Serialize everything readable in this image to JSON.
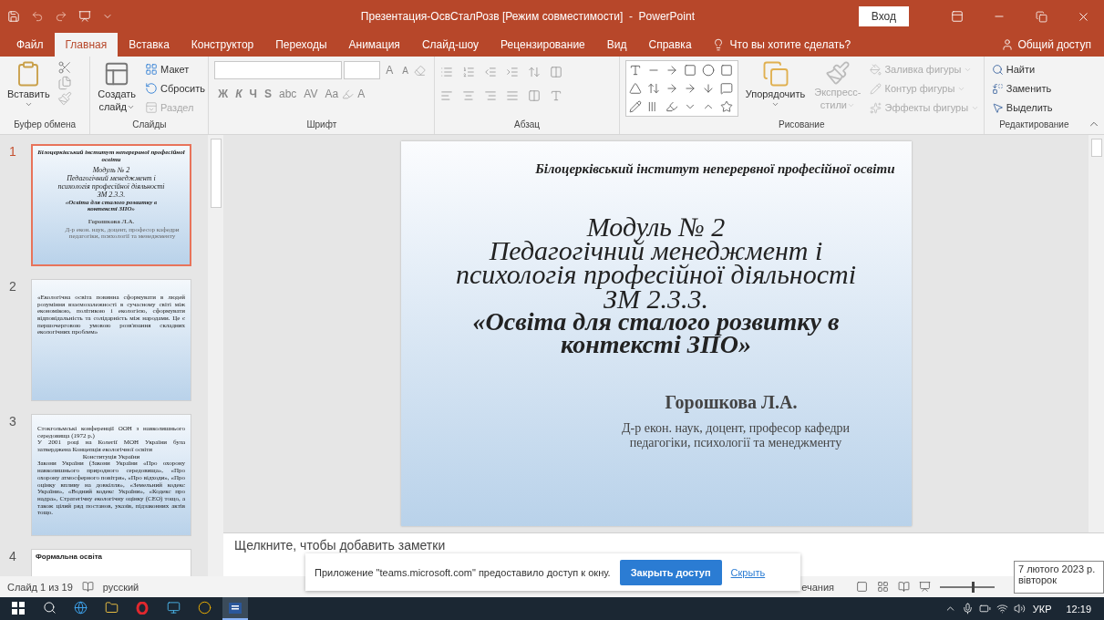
{
  "window": {
    "title": "Презентация-ОсвСталРозв [Режим совместимости]  -  PowerPoint",
    "signin": "Вход"
  },
  "menu_tabs": [
    {
      "label": "Файл",
      "selected": false
    },
    {
      "label": "Главная",
      "selected": true
    },
    {
      "label": "Вставка",
      "selected": false
    },
    {
      "label": "Конструктор",
      "selected": false
    },
    {
      "label": "Переходы",
      "selected": false
    },
    {
      "label": "Анимация",
      "selected": false
    },
    {
      "label": "Слайд-шоу",
      "selected": false
    },
    {
      "label": "Рецензирование",
      "selected": false
    },
    {
      "label": "Вид",
      "selected": false
    },
    {
      "label": "Справка",
      "selected": false
    }
  ],
  "tell_me": "Что вы хотите сделать?",
  "share": "Общий доступ",
  "ribbon": {
    "clipboard": {
      "label": "Буфер обмена",
      "paste": "Вставить"
    },
    "slides": {
      "label": "Слайды",
      "new_slide": [
        "Создать",
        "слайд"
      ],
      "items": [
        {
          "label": "Макет",
          "disabled": false
        },
        {
          "label": "Сбросить",
          "disabled": false
        },
        {
          "label": "Раздел",
          "disabled": true
        }
      ]
    },
    "font": {
      "label": "Шрифт",
      "grow": "A",
      "shrink": "A",
      "styles": [
        "Ж",
        "К",
        "Ч",
        "S",
        "abc",
        "AV",
        "Aa"
      ],
      "text_color_letter": "A"
    },
    "paragraph": {
      "label": "Абзац"
    },
    "drawing": {
      "label": "Рисование",
      "arrange": "Упорядочить",
      "quick_styles": [
        "Экспресс-",
        "стили"
      ],
      "items": [
        {
          "label": "Заливка фигуры",
          "disabled": true
        },
        {
          "label": "Контур фигуры",
          "disabled": true
        },
        {
          "label": "Эффекты фигуры",
          "disabled": true
        }
      ]
    },
    "editing": {
      "label": "Редактирование",
      "items": [
        {
          "label": "Найти"
        },
        {
          "label": "Заменить"
        },
        {
          "label": "Выделить"
        }
      ]
    }
  },
  "thumbnails": [
    {
      "number": "1",
      "selected": true,
      "kind": "title",
      "header": "Білоцерківський інститут неперервної професійної освіти",
      "title_lines": [
        {
          "text": "Модуль № 2",
          "bold": false
        },
        {
          "text": "Педагогічний менеджмент і",
          "bold": false
        },
        {
          "text": "психологія професійної діяльності",
          "bold": false
        },
        {
          "text": "ЗМ 2.3.3.",
          "bold": false
        },
        {
          "text": "«Освіта для сталого розвитку в",
          "bold": true
        },
        {
          "text": "контексті ЗПО»",
          "bold": true
        }
      ],
      "author": "Горошкова Л.А.",
      "subtitle": "Д-р екон. наук, доцент, професор кафедри педагогіки, психології та менеджменту"
    },
    {
      "number": "2",
      "selected": false,
      "kind": "text",
      "paragraphs": [
        "«Екологічна освіта повинна сформувати в людей розуміння взаємозалежності в сучасному світі між економікою, політикою і екологією, сформувати відповідальність та солідарність між народами. Це є першочерговою умовою розв'язання складних екологічних проблем»"
      ]
    },
    {
      "number": "3",
      "selected": false,
      "kind": "text",
      "paragraphs": [
        "Стокгольмські конференції ООН з навколишнього середовища (1972 р.)",
        "У 2001 році на Колегії МОН України була затверджена Концепція екологічної освіти",
        "Конституція України",
        "Закони України (Закони України «Про охорону навколишнього природного середовища», «Про охорону атмосферного повітря», «Про відходи», «Про оцінку впливу на довкілля», «Земельний кодекс України», «Водний кодекс України», «Кодекс про надра», Стратегічну екологічну оцінку (СЕО) тощо, а також цілий ряд постанов, указів, підзаконних актів тощо."
      ]
    },
    {
      "number": "4",
      "selected": false,
      "kind": "list",
      "heading": "Формальна освіта"
    }
  ],
  "slide": {
    "header": "Білоцерківський інститут неперервної професійної освіти",
    "title_lines": [
      {
        "text": "Модуль № 2",
        "bold": false
      },
      {
        "text": "Педагогічний менеджмент і",
        "bold": false
      },
      {
        "text": "психологія професійної діяльності",
        "bold": false
      },
      {
        "text": "ЗМ 2.3.3.",
        "bold": false
      },
      {
        "text": "«Освіта для сталого розвитку в",
        "bold": true
      },
      {
        "text": "контексті ЗПО»",
        "bold": true
      }
    ],
    "author": "Горошкова Л.А.",
    "subtitle": "Д-р екон. наук, доцент, професор кафедри педагогіки, психології та менеджменту"
  },
  "notes": {
    "placeholder": "Щелкните, чтобы добавить заметки"
  },
  "status_bar": {
    "slide": "Слайд 1 из 19",
    "language": "русский",
    "comments": "ечания",
    "zoom": {
      "level": 0.6
    }
  },
  "notification": {
    "text": "Приложение \"teams.microsoft.com\" предоставило доступ к окну.",
    "button": "Закрыть доступ",
    "link": "Скрыть"
  },
  "date_tooltip": {
    "date": "7 лютого 2023 р.",
    "weekday": "вівторок"
  },
  "taskbar": {
    "apps": [
      {
        "selected": false
      },
      {
        "selected": false
      },
      {
        "selected": false
      },
      {
        "selected": false
      },
      {
        "selected": false
      },
      {
        "selected": false
      },
      {
        "selected": false
      },
      {
        "selected": true
      }
    ],
    "language": "УКР",
    "time": "12:19"
  }
}
